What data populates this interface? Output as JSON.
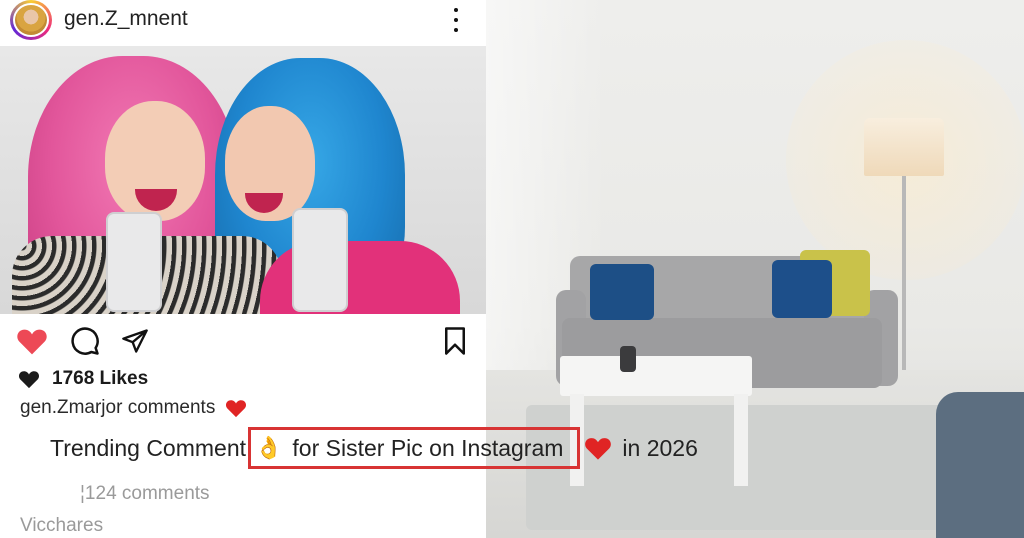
{
  "post": {
    "username": "gen.Z_mnent",
    "likes": "1768 Likes",
    "caption_user_line": "gen.Zmarjor comments",
    "comments_count": "¦124 comments",
    "shares": "Vicchares"
  },
  "headline": {
    "part1": "Trending Comment",
    "boxed_icon": "👌",
    "boxed": "for Sister Pic on Instagram",
    "part2": "in 2026"
  },
  "colors": {
    "like_red": "#ed4956",
    "highlight_box": "#d83434"
  },
  "icons": [
    "heart-icon",
    "comment-icon",
    "share-icon",
    "bookmark-icon",
    "more-icon"
  ]
}
